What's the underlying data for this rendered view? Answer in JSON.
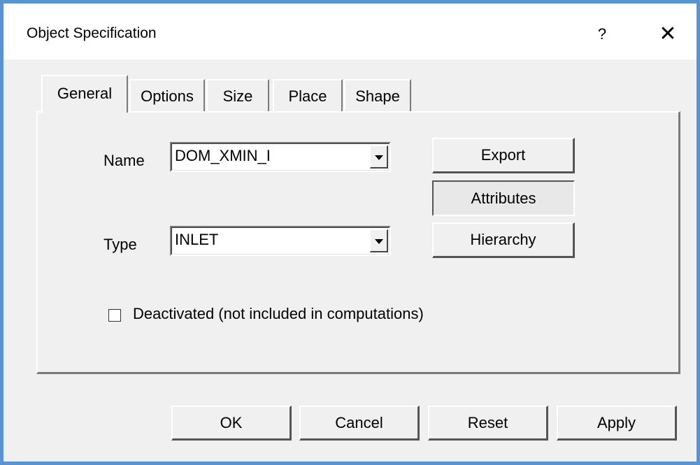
{
  "window": {
    "title": "Object Specification",
    "help_label": "?",
    "close_label": "✕"
  },
  "tabs": [
    {
      "label": "General",
      "active": true
    },
    {
      "label": "Options",
      "active": false
    },
    {
      "label": "Size",
      "active": false
    },
    {
      "label": "Place",
      "active": false
    },
    {
      "label": "Shape",
      "active": false
    }
  ],
  "general": {
    "name_label": "Name",
    "name_value": "DOM_XMIN_I",
    "type_label": "Type",
    "type_value": "INLET",
    "deactivated_label": "Deactivated (not included in computations)",
    "deactivated_checked": false
  },
  "side_buttons": {
    "export": "Export",
    "attributes": "Attributes",
    "hierarchy": "Hierarchy"
  },
  "footer": {
    "ok": "OK",
    "cancel": "Cancel",
    "reset": "Reset",
    "apply": "Apply"
  },
  "colors": {
    "window_border": "#5b93d1",
    "dialog_bg": "#f0f0f0"
  }
}
